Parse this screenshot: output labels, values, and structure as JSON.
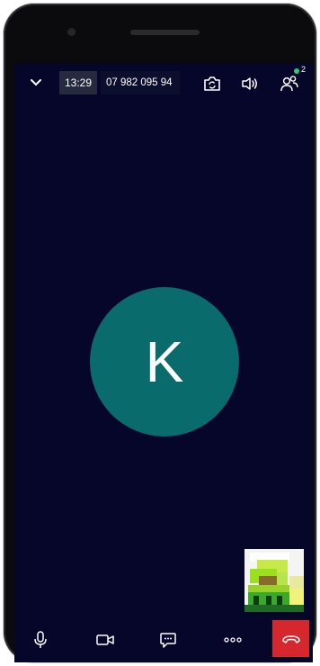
{
  "call": {
    "duration": "13:29",
    "phone_number": "07 982 095 94",
    "participant_count": "2",
    "avatar_letter": "K"
  },
  "colors": {
    "screen_bg": "#06062a",
    "avatar_bg": "#0a6b6c",
    "hangup_bg": "#d6262e",
    "badge_dot": "#2ecc71"
  },
  "icons": {
    "top": [
      "chevron-down-icon",
      "flip-camera-icon",
      "speaker-volume-icon",
      "participants-icon"
    ],
    "bottom": [
      "microphone-icon",
      "video-camera-icon",
      "chat-icon",
      "more-icon",
      "hang-up-icon"
    ]
  }
}
